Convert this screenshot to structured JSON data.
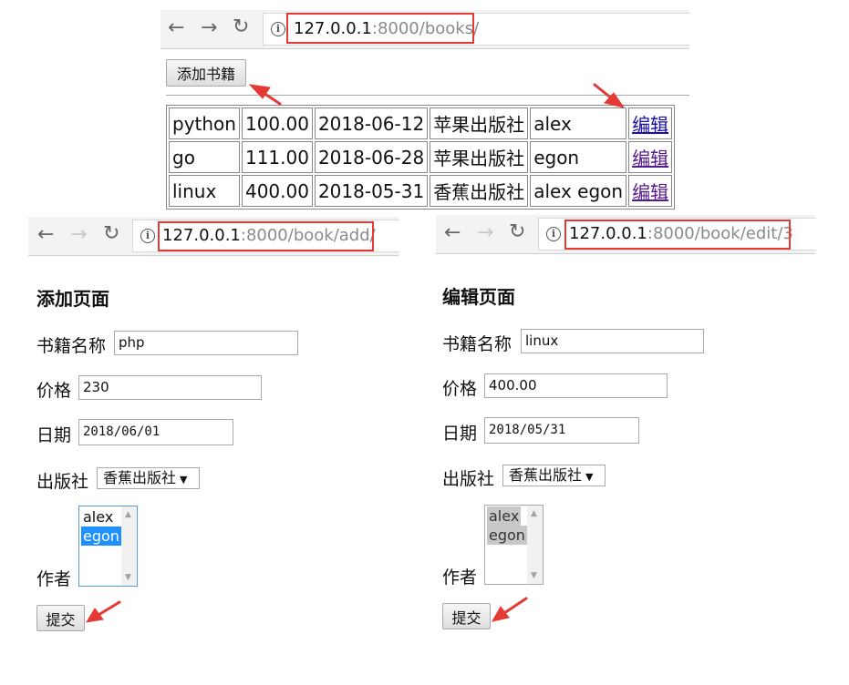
{
  "books_page": {
    "url_host": "127.0.0.1",
    "url_rest": ":8000/books/",
    "add_button": "添加书籍",
    "rows": [
      {
        "title": "python",
        "price": "100.00",
        "date": "2018-06-12",
        "publisher": "苹果出版社",
        "author": "alex",
        "action": "编辑"
      },
      {
        "title": "go",
        "price": "111.00",
        "date": "2018-06-28",
        "publisher": "苹果出版社",
        "author": "egon",
        "action": "编辑"
      },
      {
        "title": "linux",
        "price": "400.00",
        "date": "2018-05-31",
        "publisher": "香蕉出版社",
        "author": "alex egon",
        "action": "编辑"
      }
    ]
  },
  "add_page": {
    "url_host": "127.0.0.1",
    "url_rest": ":8000/book/add/",
    "heading": "添加页面",
    "title_label": "书籍名称",
    "title_value": "php",
    "price_label": "价格",
    "price_value": "230",
    "date_label": "日期",
    "date_value": "2018/06/01",
    "publisher_label": "出版社",
    "publisher_value": "香蕉出版社",
    "authors_label": "作者",
    "authors": [
      "alex",
      "egon"
    ],
    "submit": "提交"
  },
  "edit_page": {
    "url_host": "127.0.0.1",
    "url_rest": ":8000/book/edit/3",
    "heading": "编辑页面",
    "title_label": "书籍名称",
    "title_value": "linux",
    "price_label": "价格",
    "price_value": "400.00",
    "date_label": "日期",
    "date_value": "2018/05/31",
    "publisher_label": "出版社",
    "publisher_value": "香蕉出版社",
    "authors_label": "作者",
    "authors": [
      "alex",
      "egon"
    ],
    "submit": "提交"
  },
  "colors": {
    "annotation_red": "#e53935",
    "selected_blue": "#1e90ff",
    "selected_gray": "#c8c8c8",
    "link_blue": "#1a0dab"
  },
  "icons": [
    "back-arrow-icon",
    "forward-arrow-icon",
    "reload-icon",
    "info-icon",
    "caret-down-icon",
    "scroll-up-icon",
    "scroll-down-icon",
    "annotation-arrow-icon"
  ]
}
